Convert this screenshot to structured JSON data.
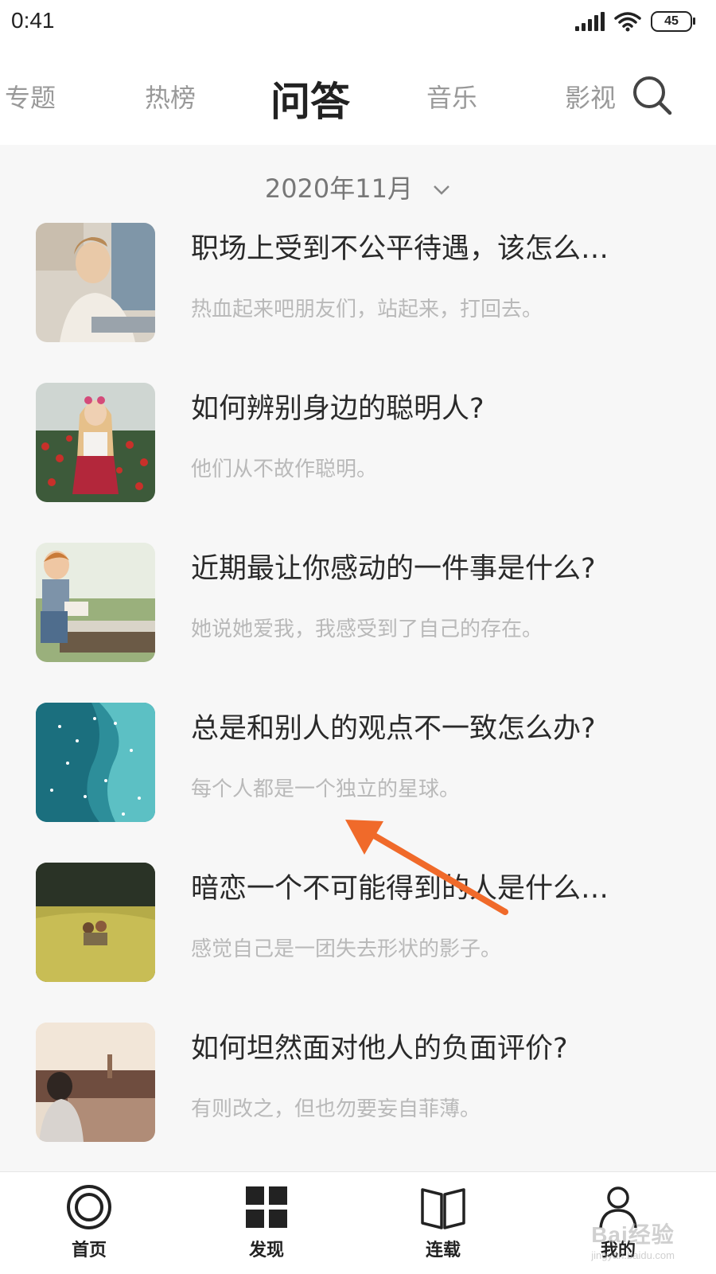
{
  "status_bar": {
    "time": "0:41",
    "battery": "45",
    "icons": [
      "signal-icon",
      "wifi-icon",
      "battery-icon"
    ]
  },
  "top_nav": {
    "tabs": [
      {
        "label": "专题",
        "active": false
      },
      {
        "label": "热榜",
        "active": false
      },
      {
        "label": "问答",
        "active": true
      },
      {
        "label": "音乐",
        "active": false
      },
      {
        "label": "影视",
        "active": false
      }
    ],
    "search_icon": "search-icon"
  },
  "month_selector": {
    "label": "2020年11月",
    "icon": "chevron-down-icon"
  },
  "questions": [
    {
      "title": "职场上受到不公平待遇，该怎么…",
      "subtitle": "热血起来吧朋友们，站起来，打回去。"
    },
    {
      "title": "如何辨别身边的聪明人?",
      "subtitle": "他们从不故作聪明。"
    },
    {
      "title": "近期最让你感动的一件事是什么?",
      "subtitle": "她说她爱我，我感受到了自己的存在。"
    },
    {
      "title": "总是和别人的观点不一致怎么办?",
      "subtitle": "每个人都是一个独立的星球。"
    },
    {
      "title": "暗恋一个不可能得到的人是什么…",
      "subtitle": "感觉自己是一团失去形状的影子。"
    },
    {
      "title": "如何坦然面对他人的负面评价?",
      "subtitle": "有则改之，但也勿要妄自菲薄。"
    }
  ],
  "bottom_nav": {
    "items": [
      {
        "label": "首页",
        "icon": "home-ring-icon"
      },
      {
        "label": "发现",
        "icon": "grid-icon"
      },
      {
        "label": "连载",
        "icon": "book-icon"
      },
      {
        "label": "我的",
        "icon": "user-icon"
      }
    ]
  },
  "watermark": {
    "text": "Bai经验",
    "sub": "jingyan.baidu.com"
  },
  "colors": {
    "annotation_arrow": "#f06a2a",
    "active_tab": "#222222",
    "inactive_tab": "#999999"
  }
}
